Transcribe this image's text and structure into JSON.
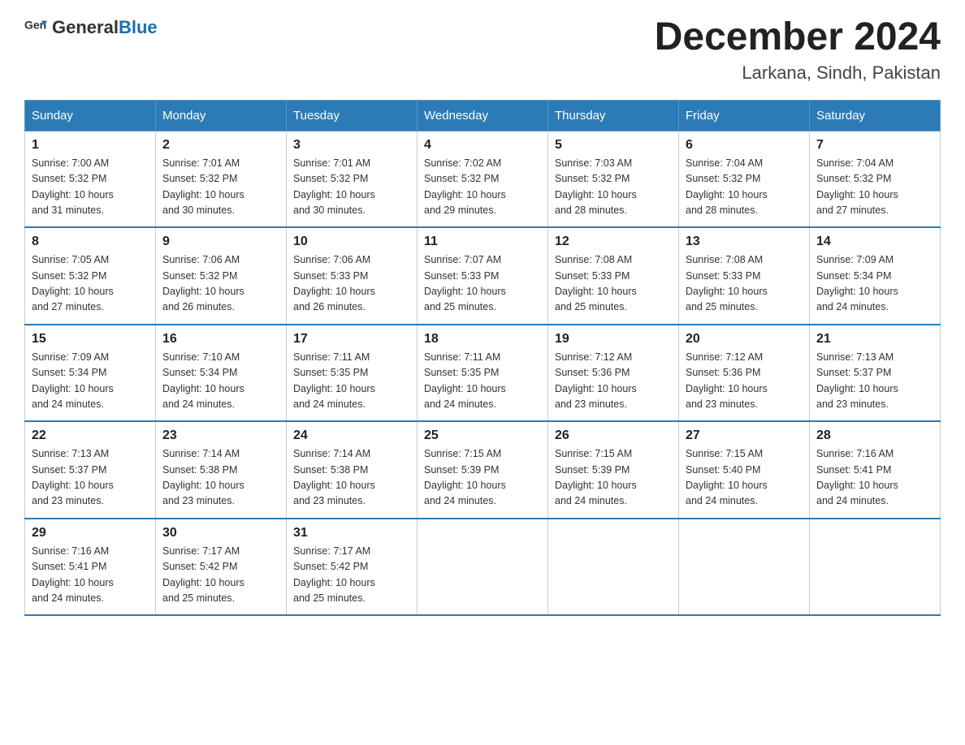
{
  "header": {
    "logo": {
      "text_general": "General",
      "text_blue": "Blue"
    },
    "title": "December 2024",
    "location": "Larkana, Sindh, Pakistan"
  },
  "calendar": {
    "headers": [
      "Sunday",
      "Monday",
      "Tuesday",
      "Wednesday",
      "Thursday",
      "Friday",
      "Saturday"
    ],
    "weeks": [
      [
        {
          "day": "1",
          "sunrise": "7:00 AM",
          "sunset": "5:32 PM",
          "daylight": "10 hours and 31 minutes."
        },
        {
          "day": "2",
          "sunrise": "7:01 AM",
          "sunset": "5:32 PM",
          "daylight": "10 hours and 30 minutes."
        },
        {
          "day": "3",
          "sunrise": "7:01 AM",
          "sunset": "5:32 PM",
          "daylight": "10 hours and 30 minutes."
        },
        {
          "day": "4",
          "sunrise": "7:02 AM",
          "sunset": "5:32 PM",
          "daylight": "10 hours and 29 minutes."
        },
        {
          "day": "5",
          "sunrise": "7:03 AM",
          "sunset": "5:32 PM",
          "daylight": "10 hours and 28 minutes."
        },
        {
          "day": "6",
          "sunrise": "7:04 AM",
          "sunset": "5:32 PM",
          "daylight": "10 hours and 28 minutes."
        },
        {
          "day": "7",
          "sunrise": "7:04 AM",
          "sunset": "5:32 PM",
          "daylight": "10 hours and 27 minutes."
        }
      ],
      [
        {
          "day": "8",
          "sunrise": "7:05 AM",
          "sunset": "5:32 PM",
          "daylight": "10 hours and 27 minutes."
        },
        {
          "day": "9",
          "sunrise": "7:06 AM",
          "sunset": "5:32 PM",
          "daylight": "10 hours and 26 minutes."
        },
        {
          "day": "10",
          "sunrise": "7:06 AM",
          "sunset": "5:33 PM",
          "daylight": "10 hours and 26 minutes."
        },
        {
          "day": "11",
          "sunrise": "7:07 AM",
          "sunset": "5:33 PM",
          "daylight": "10 hours and 25 minutes."
        },
        {
          "day": "12",
          "sunrise": "7:08 AM",
          "sunset": "5:33 PM",
          "daylight": "10 hours and 25 minutes."
        },
        {
          "day": "13",
          "sunrise": "7:08 AM",
          "sunset": "5:33 PM",
          "daylight": "10 hours and 25 minutes."
        },
        {
          "day": "14",
          "sunrise": "7:09 AM",
          "sunset": "5:34 PM",
          "daylight": "10 hours and 24 minutes."
        }
      ],
      [
        {
          "day": "15",
          "sunrise": "7:09 AM",
          "sunset": "5:34 PM",
          "daylight": "10 hours and 24 minutes."
        },
        {
          "day": "16",
          "sunrise": "7:10 AM",
          "sunset": "5:34 PM",
          "daylight": "10 hours and 24 minutes."
        },
        {
          "day": "17",
          "sunrise": "7:11 AM",
          "sunset": "5:35 PM",
          "daylight": "10 hours and 24 minutes."
        },
        {
          "day": "18",
          "sunrise": "7:11 AM",
          "sunset": "5:35 PM",
          "daylight": "10 hours and 24 minutes."
        },
        {
          "day": "19",
          "sunrise": "7:12 AM",
          "sunset": "5:36 PM",
          "daylight": "10 hours and 23 minutes."
        },
        {
          "day": "20",
          "sunrise": "7:12 AM",
          "sunset": "5:36 PM",
          "daylight": "10 hours and 23 minutes."
        },
        {
          "day": "21",
          "sunrise": "7:13 AM",
          "sunset": "5:37 PM",
          "daylight": "10 hours and 23 minutes."
        }
      ],
      [
        {
          "day": "22",
          "sunrise": "7:13 AM",
          "sunset": "5:37 PM",
          "daylight": "10 hours and 23 minutes."
        },
        {
          "day": "23",
          "sunrise": "7:14 AM",
          "sunset": "5:38 PM",
          "daylight": "10 hours and 23 minutes."
        },
        {
          "day": "24",
          "sunrise": "7:14 AM",
          "sunset": "5:38 PM",
          "daylight": "10 hours and 23 minutes."
        },
        {
          "day": "25",
          "sunrise": "7:15 AM",
          "sunset": "5:39 PM",
          "daylight": "10 hours and 24 minutes."
        },
        {
          "day": "26",
          "sunrise": "7:15 AM",
          "sunset": "5:39 PM",
          "daylight": "10 hours and 24 minutes."
        },
        {
          "day": "27",
          "sunrise": "7:15 AM",
          "sunset": "5:40 PM",
          "daylight": "10 hours and 24 minutes."
        },
        {
          "day": "28",
          "sunrise": "7:16 AM",
          "sunset": "5:41 PM",
          "daylight": "10 hours and 24 minutes."
        }
      ],
      [
        {
          "day": "29",
          "sunrise": "7:16 AM",
          "sunset": "5:41 PM",
          "daylight": "10 hours and 24 minutes."
        },
        {
          "day": "30",
          "sunrise": "7:17 AM",
          "sunset": "5:42 PM",
          "daylight": "10 hours and 25 minutes."
        },
        {
          "day": "31",
          "sunrise": "7:17 AM",
          "sunset": "5:42 PM",
          "daylight": "10 hours and 25 minutes."
        },
        null,
        null,
        null,
        null
      ]
    ],
    "labels": {
      "sunrise": "Sunrise:",
      "sunset": "Sunset:",
      "daylight": "Daylight:"
    }
  }
}
